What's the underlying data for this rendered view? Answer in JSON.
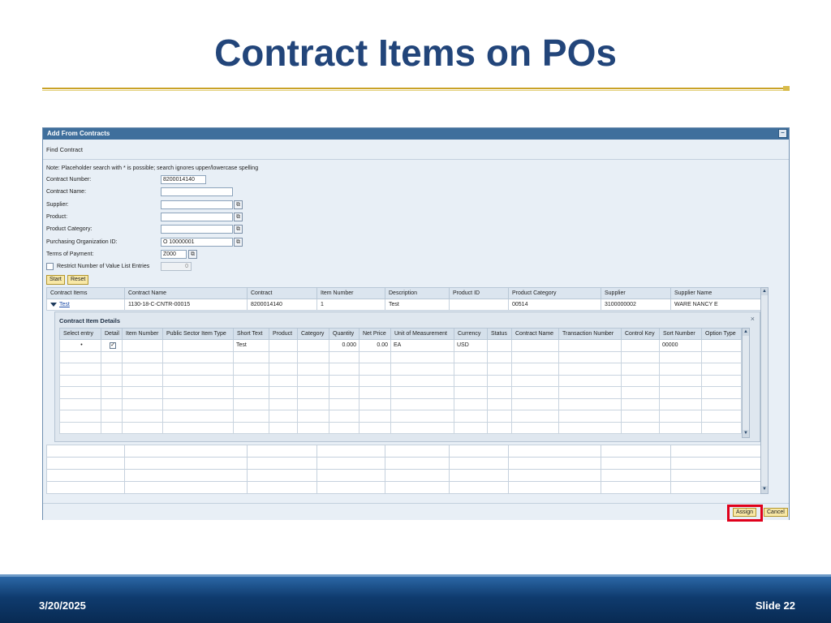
{
  "slide": {
    "title": "Contract Items on POs",
    "date": "3/20/2025",
    "slide_number": "Slide 22"
  },
  "sap": {
    "window_title": "Add From Contracts",
    "find_contract_label": "Find Contract",
    "note": "Note: Placeholder search with * is possible; search ignores upper/lowercase spelling",
    "fields": {
      "contract_number_label": "Contract Number:",
      "contract_number_value": "8200014140",
      "contract_name_label": "Contract Name:",
      "contract_name_value": "",
      "supplier_label": "Supplier:",
      "supplier_value": "",
      "product_label": "Product:",
      "product_value": "",
      "product_category_label": "Product Category:",
      "product_category_value": "",
      "purchasing_org_label": "Purchasing Organization ID:",
      "purchasing_org_value": "O 10000001",
      "terms_of_payment_label": "Terms of Payment:",
      "terms_of_payment_value": "Z000",
      "restrict_label": "Restrict Number of Value List Entries",
      "restrict_value": "0"
    },
    "buttons": {
      "start": "Start",
      "reset": "Reset",
      "assign": "Assign",
      "cancel": "Cancel"
    },
    "contract_table": {
      "headers": [
        "Contract Items",
        "Contract Name",
        "Contract",
        "Item Number",
        "Description",
        "Product ID",
        "Product Category",
        "Supplier",
        "Supplier Name"
      ],
      "row": {
        "contract_items": "Test",
        "contract_name": "1130-18-C-CNTR-00015",
        "contract": "8200014140",
        "item_number": "1",
        "description": "Test",
        "product_id": "",
        "product_category": "00514",
        "supplier": "3100000002",
        "supplier_name": "WARE NANCY E"
      }
    },
    "detail": {
      "title": "Contract Item Details",
      "headers": [
        "Select entry",
        "Detail",
        "Item Number",
        "Public Sector Item Type",
        "Short Text",
        "Product",
        "Category",
        "Quantity",
        "Net Price",
        "Unit of Measurement",
        "Currency",
        "Status",
        "Contract Name",
        "Transaction Number",
        "Control Key",
        "Sort Number",
        "Option Type"
      ],
      "row": {
        "select_entry": "•",
        "short_text": "Test",
        "quantity": "0.000",
        "net_price": "0.00",
        "uom": "EA",
        "currency": "USD",
        "sort_number": "00000"
      }
    }
  },
  "colors": {
    "title": "#22457a",
    "sap_header": "#3f6f9c",
    "highlight": "#e0001b",
    "button": "#f8e8a6"
  },
  "icons": {
    "minimize": "minimize-icon",
    "value_help": "value-help-icon",
    "close": "close-icon",
    "expand": "expand-triangle-icon"
  }
}
